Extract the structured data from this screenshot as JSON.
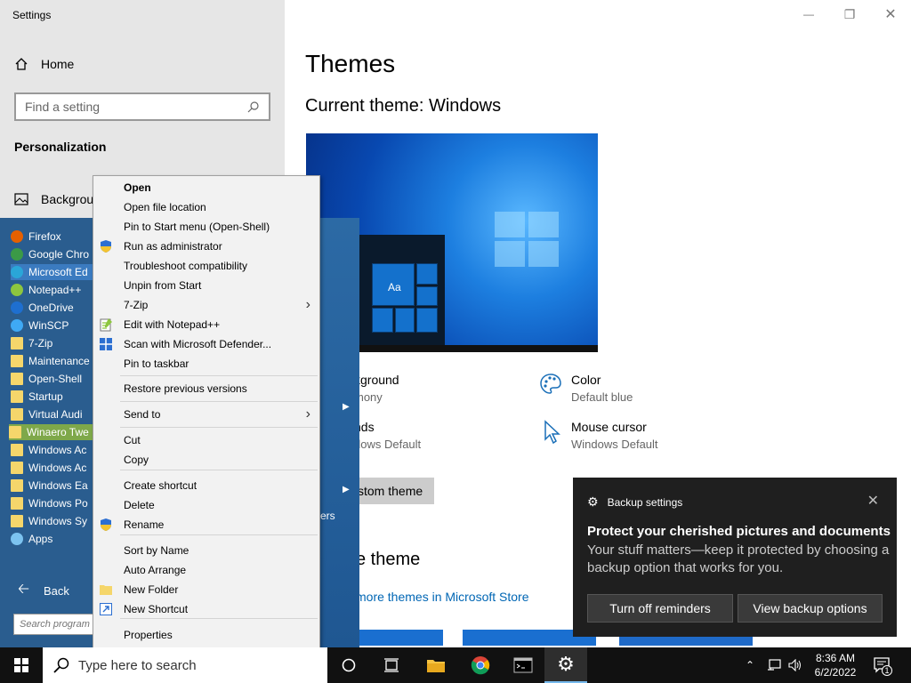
{
  "window": {
    "title": "Settings"
  },
  "sidebar": {
    "home": "Home",
    "search_placeholder": "Find a setting",
    "section": "Personalization",
    "background_item": "Backgrou"
  },
  "main": {
    "title": "Themes",
    "current_theme": "Current theme: Windows",
    "background": {
      "label": "kground",
      "value": "mony"
    },
    "color": {
      "label": "Color",
      "value": "Default blue"
    },
    "sounds": {
      "label": "nds",
      "value": "dows Default"
    },
    "mouse_cursor": {
      "label": "Mouse cursor",
      "value": "Windows Default"
    },
    "custom_theme_button": "stom theme",
    "apply_theme_heading": "e theme",
    "store_link": "more themes in Microsoft Store"
  },
  "start_menu": {
    "programs": [
      {
        "label": "Firefox",
        "icon": "firefox-icon",
        "color": "#e66000"
      },
      {
        "label": "Google Chro",
        "icon": "chrome-icon",
        "color": "#3b9a47"
      },
      {
        "label": "Microsoft Ed",
        "icon": "edge-icon",
        "color": "#2aa6d8"
      },
      {
        "label": "Notepad++",
        "icon": "notepadpp-icon",
        "color": "#8dc63f"
      },
      {
        "label": "OneDrive",
        "icon": "onedrive-icon",
        "color": "#1e6fd0"
      },
      {
        "label": "WinSCP",
        "icon": "winscp-icon",
        "color": "#3fa9f5"
      },
      {
        "label": "7-Zip",
        "icon": "folder-icon",
        "color": "#f5d66b"
      },
      {
        "label": "Maintenance",
        "icon": "folder-icon",
        "color": "#f5d66b"
      },
      {
        "label": "Open-Shell",
        "icon": "folder-icon",
        "color": "#f5d66b"
      },
      {
        "label": "Startup",
        "icon": "folder-icon",
        "color": "#f5d66b"
      },
      {
        "label": "Virtual Audi",
        "icon": "folder-icon",
        "color": "#f5d66b"
      },
      {
        "label": "Winaero Twe",
        "icon": "folder-icon",
        "color": "#f5d66b"
      },
      {
        "label": "Windows Ac",
        "icon": "folder-icon",
        "color": "#f5d66b"
      },
      {
        "label": "Windows Ac",
        "icon": "folder-icon",
        "color": "#f5d66b"
      },
      {
        "label": "Windows Ea",
        "icon": "folder-icon",
        "color": "#f5d66b"
      },
      {
        "label": "Windows Po",
        "icon": "folder-icon",
        "color": "#f5d66b"
      },
      {
        "label": "Windows Sy",
        "icon": "folder-icon",
        "color": "#f5d66b"
      },
      {
        "label": "Apps",
        "icon": "apps-icon",
        "color": "#7cc3f0"
      }
    ],
    "back": "Back",
    "search_placeholder": "Search program",
    "partial_text": "ers"
  },
  "context_menu": {
    "items": [
      {
        "label": "Open",
        "bold": true
      },
      {
        "label": "Open file location"
      },
      {
        "label": "Pin to Start menu (Open-Shell)"
      },
      {
        "label": "Run as administrator",
        "icon": "shield-icon"
      },
      {
        "label": "Troubleshoot compatibility"
      },
      {
        "label": "Unpin from Start"
      },
      {
        "label": "7-Zip",
        "submenu": true
      },
      {
        "label": "Edit with Notepad++",
        "icon": "notepadpp-icon"
      },
      {
        "label": "Scan with Microsoft Defender...",
        "icon": "defender-icon"
      },
      {
        "label": "Pin to taskbar"
      },
      {
        "label": "Restore previous versions"
      },
      {
        "label": "Send to",
        "submenu": true
      },
      {
        "label": "Cut"
      },
      {
        "label": "Copy"
      },
      {
        "label": "Create shortcut"
      },
      {
        "label": "Delete"
      },
      {
        "label": "Rename",
        "icon": "shield-icon"
      },
      {
        "label": "Sort by Name"
      },
      {
        "label": "Auto Arrange"
      },
      {
        "label": "New Folder",
        "icon": "folder-icon"
      },
      {
        "label": "New Shortcut",
        "icon": "shortcut-icon"
      },
      {
        "label": "Properties"
      }
    ]
  },
  "notification": {
    "app": "Backup settings",
    "heading": "Protect your cherished pictures and documents",
    "body": "Your stuff matters—keep it protected by choosing a backup option that works for you.",
    "btn_off": "Turn off reminders",
    "btn_view": "View backup options"
  },
  "taskbar": {
    "search_placeholder": "Type here to search",
    "time": "8:36 AM",
    "date": "6/2/2022",
    "notification_count": "1"
  },
  "colors": {
    "accent": "#0078d7",
    "link": "#0066b4",
    "startmenu": "#2a5d8f"
  }
}
